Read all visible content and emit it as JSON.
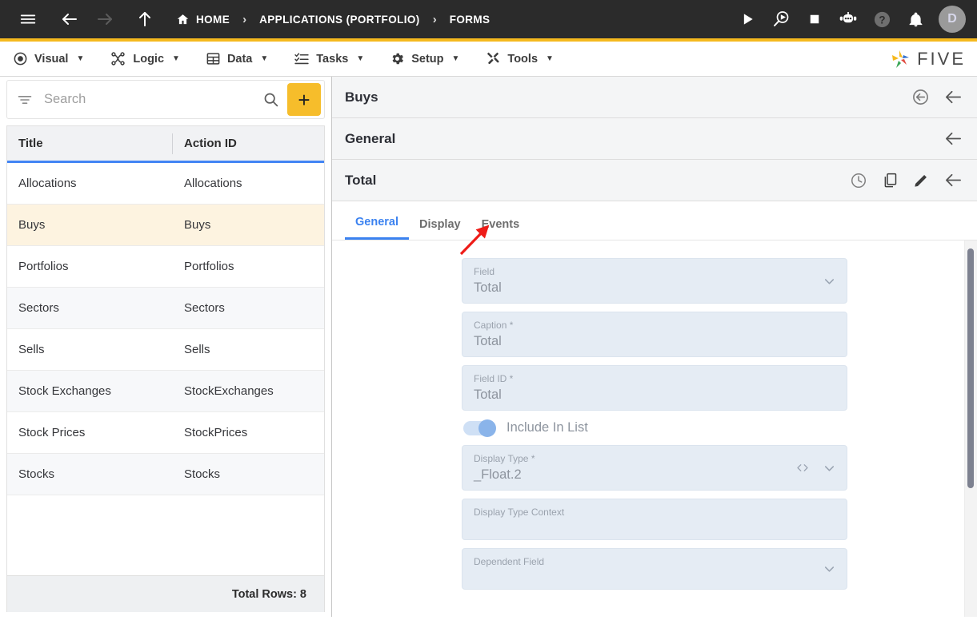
{
  "topbar": {
    "menu_icon": "hamburger-icon",
    "back_icon": "arrow-left-icon",
    "forward_icon": "arrow-right-icon",
    "up_icon": "arrow-up-icon",
    "breadcrumbs": [
      {
        "label": "HOME",
        "icon": "home-icon"
      },
      {
        "label": "APPLICATIONS (PORTFOLIO)",
        "icon": ""
      },
      {
        "label": "FORMS",
        "icon": ""
      }
    ],
    "separator": "›",
    "actions": [
      {
        "name": "run-icon",
        "title": "Run"
      },
      {
        "name": "debug-icon",
        "title": "Debug"
      },
      {
        "name": "stop-icon",
        "title": "Stop"
      },
      {
        "name": "bot-icon",
        "title": "Assistant"
      },
      {
        "name": "help-icon",
        "title": "Help"
      },
      {
        "name": "bell-icon",
        "title": "Notifications"
      }
    ],
    "avatar_initial": "D",
    "accent_bar_color": "#f5b91e",
    "background": "#2b2b2b"
  },
  "menubar": {
    "items": [
      {
        "label": "Visual",
        "icon": "eye-icon",
        "caret": "▼"
      },
      {
        "label": "Logic",
        "icon": "logic-nodes-icon",
        "caret": "▼"
      },
      {
        "label": "Data",
        "icon": "grid-icon",
        "caret": "▼"
      },
      {
        "label": "Tasks",
        "icon": "checklist-icon",
        "caret": "▼"
      },
      {
        "label": "Setup",
        "icon": "gear-icon",
        "caret": "▼"
      },
      {
        "label": "Tools",
        "icon": "tools-icon",
        "caret": "▼"
      }
    ],
    "logo_text": "FIVE"
  },
  "sidebar": {
    "search": {
      "placeholder": "Search",
      "value": "",
      "filter_icon": "filter-icon",
      "search_icon": "search-icon",
      "add_label": "+"
    },
    "table": {
      "columns": [
        "Title",
        "Action ID"
      ],
      "rows": [
        {
          "title": "Allocations",
          "action_id": "Allocations"
        },
        {
          "title": "Buys",
          "action_id": "Buys"
        },
        {
          "title": "Portfolios",
          "action_id": "Portfolios"
        },
        {
          "title": "Sectors",
          "action_id": "Sectors"
        },
        {
          "title": "Sells",
          "action_id": "Sells"
        },
        {
          "title": "Stock Exchanges",
          "action_id": "StockExchanges"
        },
        {
          "title": "Stock Prices",
          "action_id": "StockPrices"
        },
        {
          "title": "Stocks",
          "action_id": "Stocks"
        }
      ],
      "selected_index": 1,
      "footer": "Total Rows: 8",
      "header_underline_color": "#4285f4",
      "selected_row_color": "#fdf3e0"
    }
  },
  "detail": {
    "breadcrumb_panels": [
      {
        "title": "Buys",
        "icons": [
          "revert-icon",
          "arrow-left-icon"
        ]
      },
      {
        "title": "General",
        "icons": [
          "arrow-left-icon"
        ]
      },
      {
        "title": "Total",
        "icons": [
          "history-clock-icon",
          "copy-icon",
          "edit-pencil-icon",
          "arrow-left-icon"
        ]
      }
    ],
    "tabs": [
      {
        "label": "General",
        "active": true
      },
      {
        "label": "Display",
        "active": false
      },
      {
        "label": "Events",
        "active": false
      }
    ],
    "fields": [
      {
        "label": "Field",
        "value": "Total",
        "type": "select",
        "icons": [
          "chevron-down-icon"
        ]
      },
      {
        "label": "Caption *",
        "value": "Total",
        "type": "text",
        "icons": []
      },
      {
        "label": "Field ID *",
        "value": "Total",
        "type": "text",
        "icons": []
      },
      {
        "label": "Display Type *",
        "value": "_Float.2",
        "type": "select",
        "icons": [
          "code-icon",
          "chevron-down-icon"
        ]
      },
      {
        "label": "Display Type Context",
        "value": "",
        "type": "text",
        "icons": []
      },
      {
        "label": "Dependent Field",
        "value": "",
        "type": "select",
        "icons": [
          "chevron-down-icon"
        ]
      }
    ],
    "toggle": {
      "label": "Include In List",
      "on": true
    },
    "field_bg_color": "#e5ecf4",
    "active_tab_color": "#3b82f0"
  },
  "annotation": {
    "type": "red-arrow",
    "color": "#ee1c18",
    "points_to": "Events"
  }
}
